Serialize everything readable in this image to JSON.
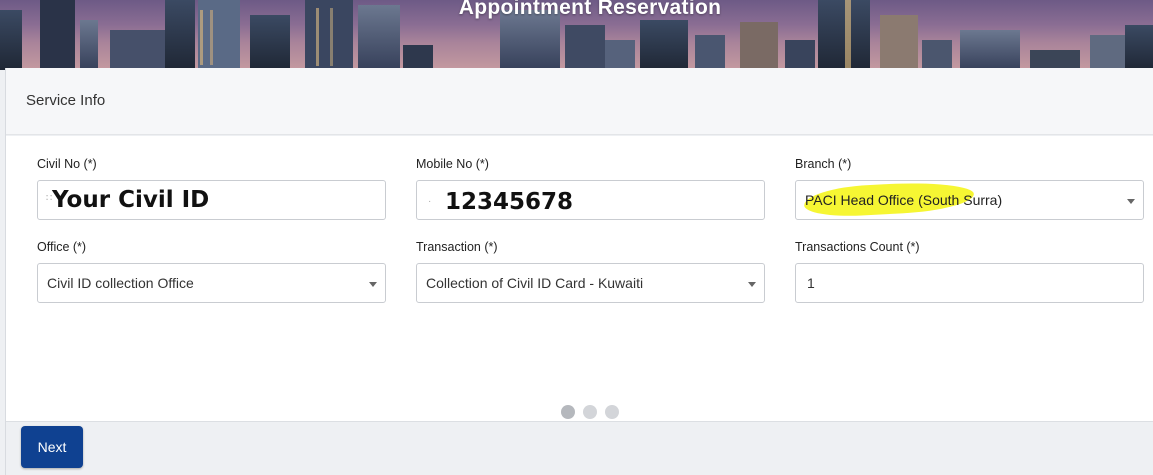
{
  "banner": {
    "title": "Appointment Reservation"
  },
  "panel": {
    "title": "Service Info"
  },
  "fields": {
    "civil_no": {
      "label": "Civil No (*)",
      "value": "Your Civil ID"
    },
    "mobile_no": {
      "label": "Mobile No (*)",
      "value": "12345678"
    },
    "branch": {
      "label": "Branch (*)",
      "value": "PACI Head Office (South Surra)"
    },
    "office": {
      "label": "Office (*)",
      "value": "Civil ID collection Office"
    },
    "transaction": {
      "label": "Transaction (*)",
      "value": "Collection of Civil ID Card - Kuwaiti"
    },
    "transactions_count": {
      "label": "Transactions Count (*)",
      "value": "1"
    }
  },
  "pager": {
    "total_steps": 3,
    "active_step": 1
  },
  "actions": {
    "next_label": "Next"
  },
  "colors": {
    "primary_button": "#0f4191",
    "highlight": "#f5f528"
  },
  "icons": {
    "select_caret": "caret-down-icon"
  }
}
